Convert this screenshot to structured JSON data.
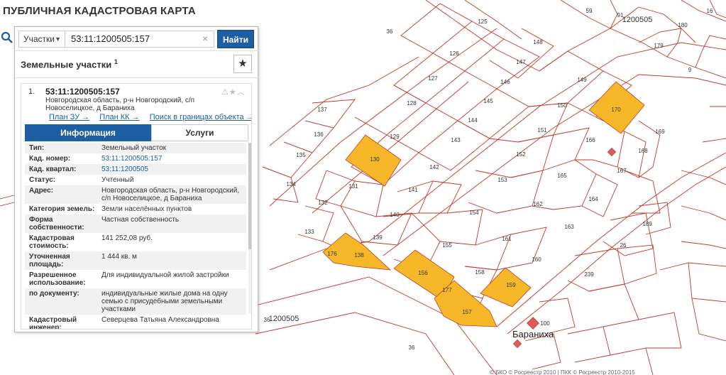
{
  "title": "ПУБЛИЧНАЯ КАДАСТРОВАЯ КАРТА",
  "search": {
    "type_label": "Участки",
    "query": "53:11:1200505:157",
    "find_label": "Найти"
  },
  "results": {
    "header": "Земельные участки",
    "count": "1"
  },
  "card": {
    "index": "1.",
    "cadastral_number": "53:11:1200505:157",
    "address": "Новгородская область, р-н Новгородский, с/п Новоселицкое, д Бараниха",
    "links": [
      "План ЗУ →",
      "План КК →",
      "Поиск в границах объекта →"
    ],
    "tabs": [
      "Информация",
      "Услуги"
    ],
    "fields": [
      {
        "k": "Тип:",
        "v": "Земельный участок",
        "link": false
      },
      {
        "k": "Кад. номер:",
        "v": "53:11:1200505:157",
        "link": true
      },
      {
        "k": "Кад. квартал:",
        "v": "53:11:1200505",
        "link": true
      },
      {
        "k": "Статус:",
        "v": "Учтенный",
        "link": false
      },
      {
        "k": "Адрес:",
        "v": "Новгородская область, р-н Новгородский, с/п Новоселицкое, д Бараниха",
        "link": false
      },
      {
        "k": "Категория земель:",
        "v": "Земли населённых пунктов",
        "link": false
      },
      {
        "k": "Форма собственности:",
        "v": "Частная собственность",
        "link": false
      },
      {
        "k": "Кадастровая стоимость:",
        "v": "141 252,08 руб.",
        "link": false
      },
      {
        "k": "Уточненная площадь:",
        "v": "1 444 кв. м",
        "link": false
      },
      {
        "k": "Разрешенное использование:",
        "v": "Для индивидуальной жилой застройки",
        "link": false
      },
      {
        "k": "по документу:",
        "v": "индивидуальные жилые дома на одну семью с присудебными земельными участками",
        "link": false
      },
      {
        "k": "Кадастровый инженер:",
        "v": "Северцева Татьяна Александровна",
        "link": false
      }
    ]
  },
  "map": {
    "parcel_labels": [
      "125",
      "59",
      "91",
      "1200505",
      "16",
      "180",
      "126",
      "148",
      "147",
      "179",
      "9",
      "127",
      "146",
      "149",
      "128",
      "145",
      "150",
      "170",
      "137",
      "144",
      "151",
      "169",
      "129",
      "143",
      "166",
      "168",
      "136",
      "130",
      "142",
      "152",
      "167",
      "135",
      "165",
      "153",
      "131",
      "134",
      "141",
      "164",
      "162",
      "132",
      "154",
      "140",
      "163",
      "189",
      "133",
      "155",
      "161",
      "139",
      "26",
      "138",
      "176",
      "156",
      "160",
      "158",
      "239",
      "159",
      "157",
      "100",
      "36",
      "1200505",
      "36",
      "36",
      "177"
    ],
    "village": "Бараниха",
    "copyright": "© БКО © Росреестр 2010 | ПКК © Росреестр 2010-2015"
  }
}
